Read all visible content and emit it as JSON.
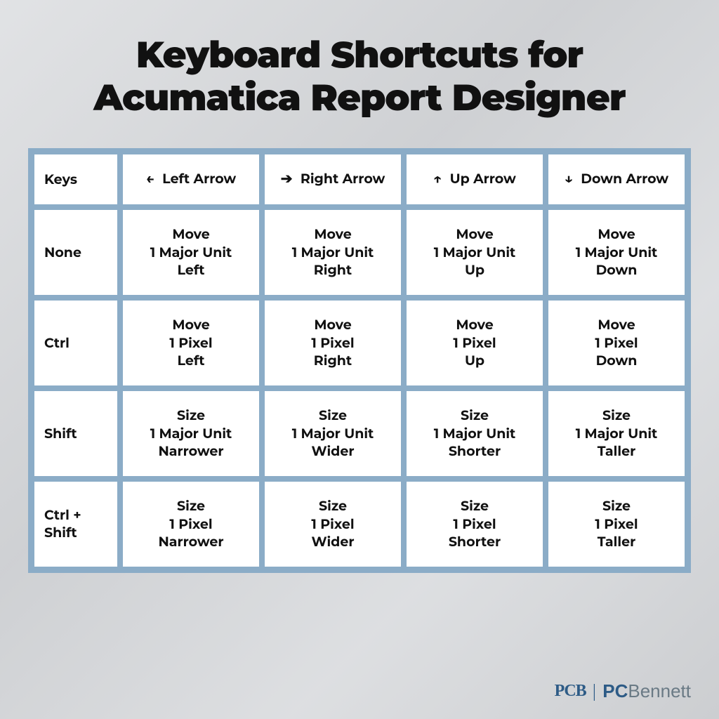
{
  "title": "Keyboard Shortcuts for Acumatica Report Designer",
  "columns": [
    {
      "key": "keys",
      "label": "Keys"
    },
    {
      "key": "left",
      "label": "Left Arrow",
      "glyph": "←"
    },
    {
      "key": "right",
      "label": "Right Arrow",
      "glyph": "➔"
    },
    {
      "key": "up",
      "label": "Up Arrow",
      "glyph": "↑"
    },
    {
      "key": "down",
      "label": "Down Arrow",
      "glyph": "↓"
    }
  ],
  "rows": [
    {
      "modifier": "None",
      "left": "Move\n1 Major Unit\nLeft",
      "right": "Move\n1 Major Unit\nRight",
      "up": "Move\n1 Major Unit\nUp",
      "down": "Move\n1 Major Unit\nDown"
    },
    {
      "modifier": "Ctrl",
      "left": "Move\n1 Pixel\nLeft",
      "right": "Move\n1 Pixel\nRight",
      "up": "Move\n1 Pixel\nUp",
      "down": "Move\n1 Pixel\nDown"
    },
    {
      "modifier": "Shift",
      "left": "Size\n1 Major Unit\nNarrower",
      "right": "Size\n1 Major Unit\nWider",
      "up": "Size\n1 Major Unit\nShorter",
      "down": "Size\n1 Major Unit\nTaller"
    },
    {
      "modifier": "Ctrl + Shift",
      "left": "Size\n1 Pixel\nNarrower",
      "right": "Size\n1 Pixel\nWider",
      "up": "Size\n1 Pixel\nShorter",
      "down": "Size\n1 Pixel\nTaller"
    }
  ],
  "footer": {
    "mark": "PCB",
    "brand_bold": "PC",
    "brand_light": "Bennett"
  }
}
